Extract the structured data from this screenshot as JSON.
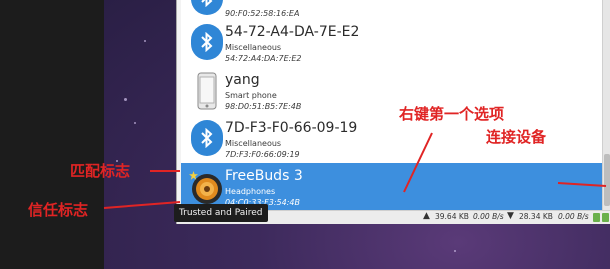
{
  "devices": [
    {
      "name": "",
      "type": "",
      "address": "90:F0:52:58:16:EA",
      "icon": "bluetooth-icon",
      "selected": false
    },
    {
      "name": "54-72-A4-DA-7E-E2",
      "type": "Miscellaneous",
      "address": "54:72:A4:DA:7E:E2",
      "icon": "bluetooth-icon",
      "selected": false
    },
    {
      "name": "yang",
      "type": "Smart phone",
      "address": "98:D0:51:B5:7E:4B",
      "icon": "smartphone-icon",
      "selected": false
    },
    {
      "name": "7D-F3-F0-66-09-19",
      "type": "Miscellaneous",
      "address": "7D:F3:F0:66:09:19",
      "icon": "bluetooth-icon",
      "selected": false
    },
    {
      "name": "FreeBuds 3",
      "type": "Headphones",
      "address": "04:C0:33:F3:54:4B",
      "icon": "headphones-icon",
      "selected": true
    }
  ],
  "tooltip": "Trusted and Paired",
  "status": {
    "upload": "39.64 KB",
    "upload_rate": "0.00 B/s",
    "download": "28.34 KB",
    "download_rate": "0.00 B/s"
  },
  "annotations": {
    "right_click_line1": "右键第一个选项",
    "right_click_line2": "连接设备",
    "pair_mark": "匹配标志",
    "trust_mark": "信任标志"
  },
  "colors": {
    "selection": "#3d8fde",
    "bluetooth": "#2f86d6",
    "annotation": "#e02424"
  }
}
